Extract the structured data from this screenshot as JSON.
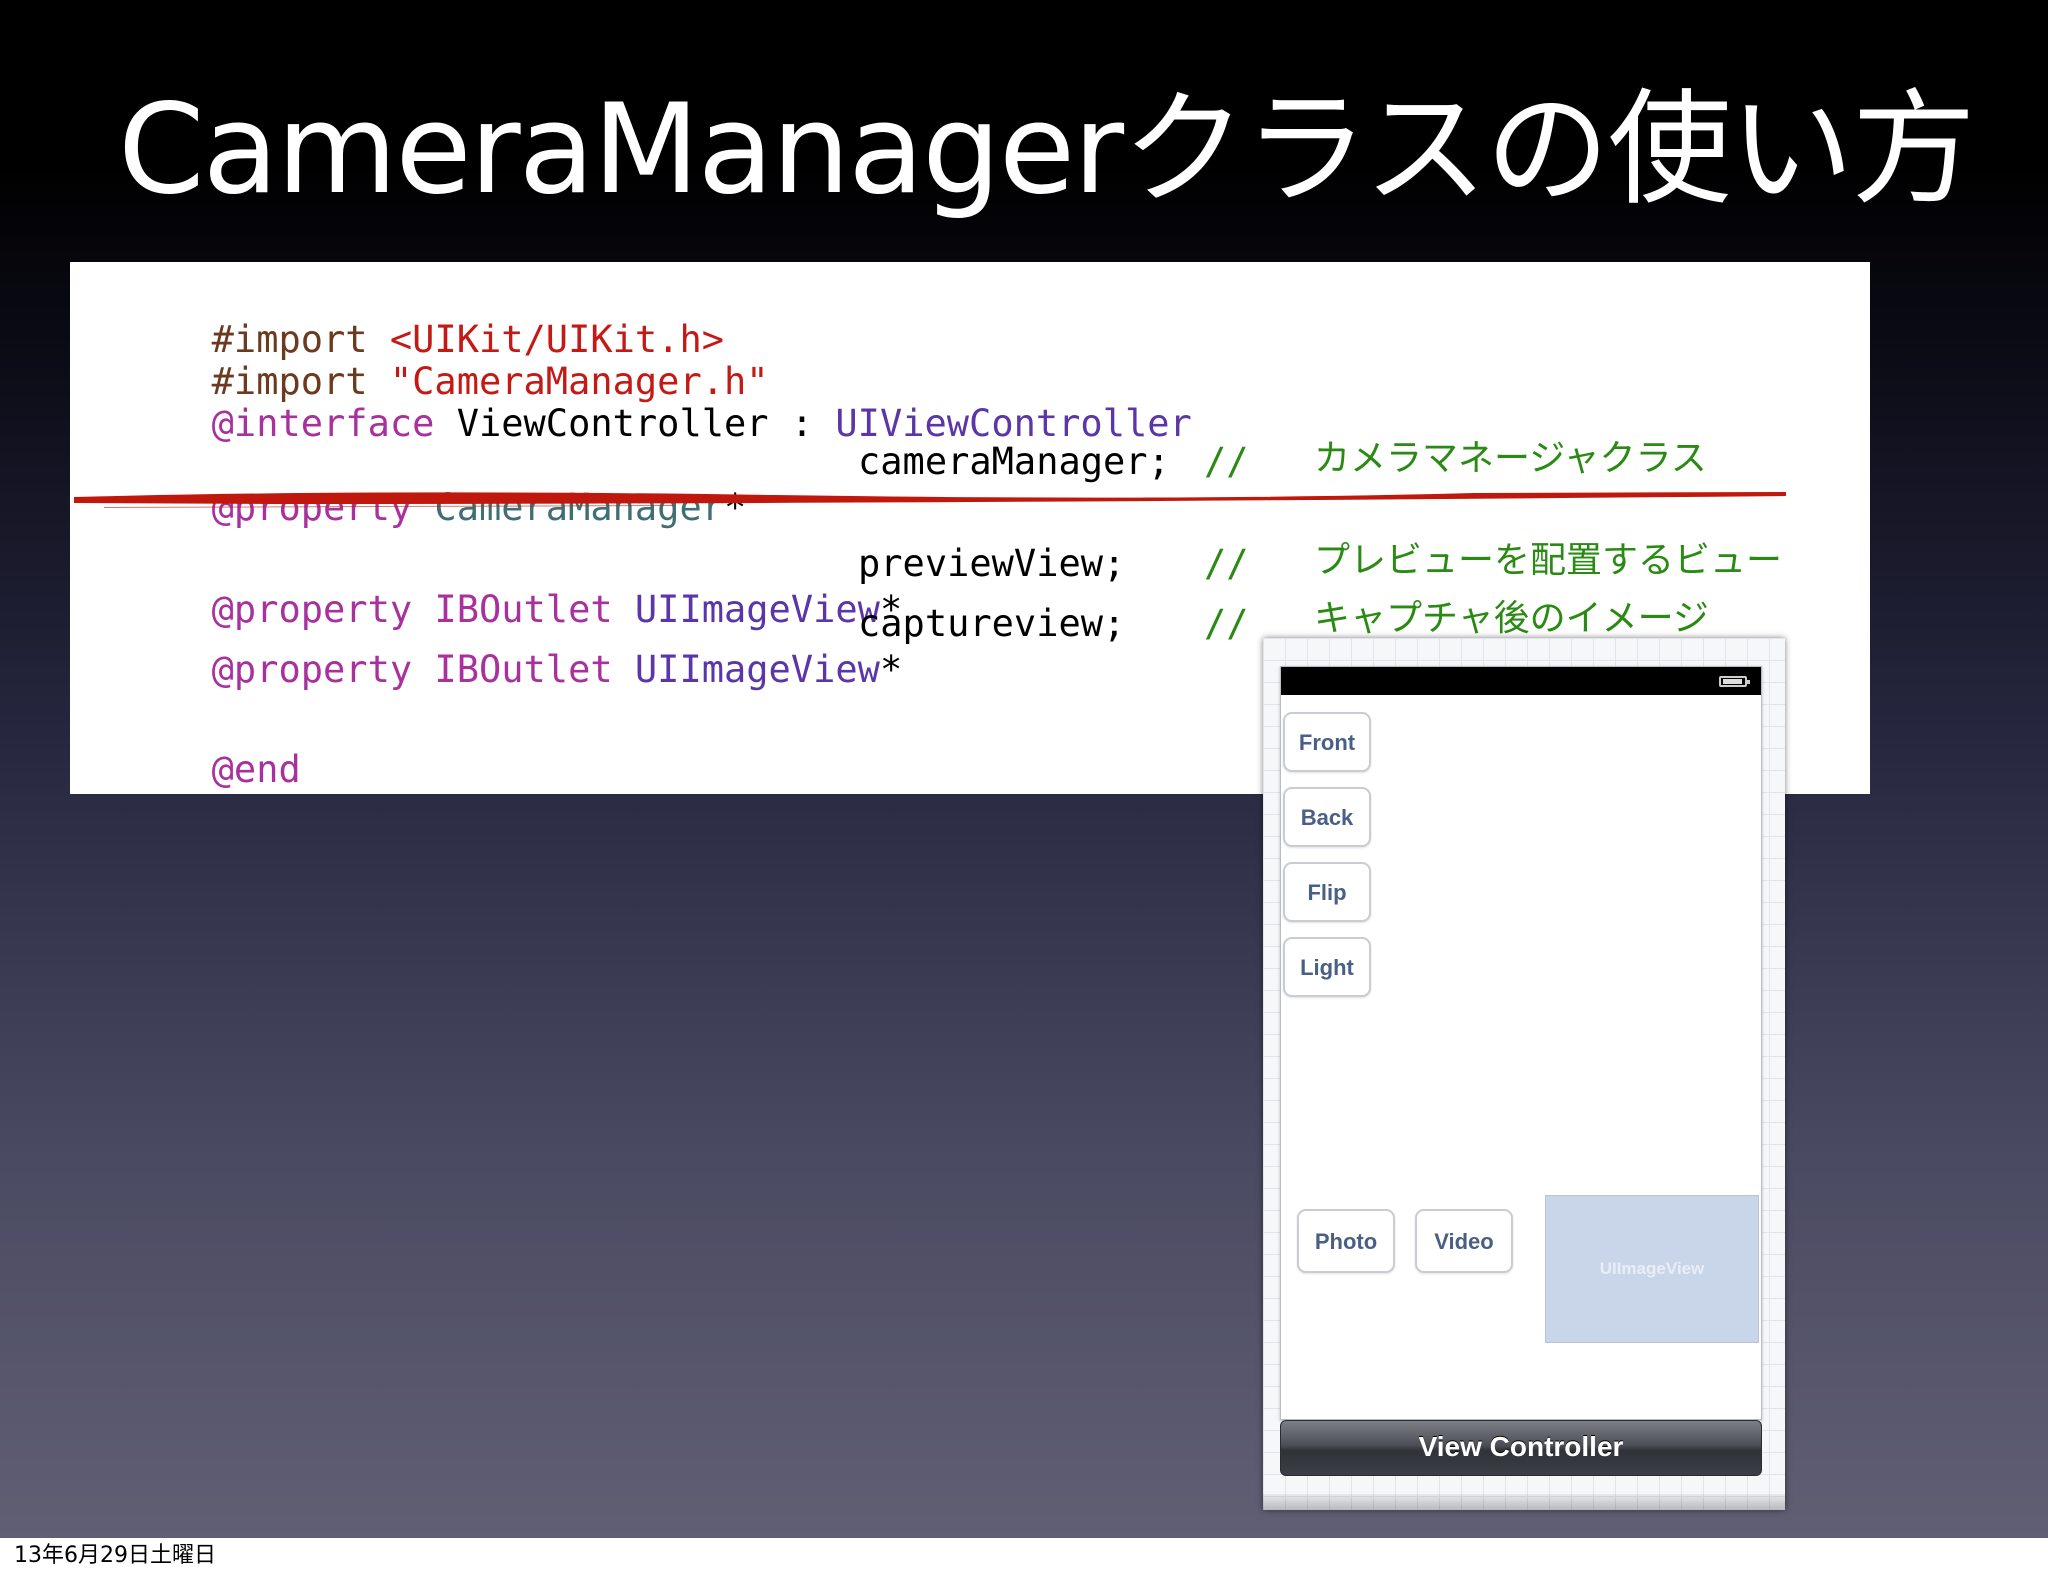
{
  "slide": {
    "title": "CameraManagerクラスの使い方",
    "footer_date": "13年6月29日土曜日"
  },
  "code": {
    "line1": {
      "directive": "#import ",
      "target": "<UIKit/UIKit.h>"
    },
    "line2": {
      "directive": "#import ",
      "target": "\"CameraManager.h\""
    },
    "line3": {
      "keyword": "@interface",
      "name": " ViewController : ",
      "superclass": "UIViewController"
    },
    "line4": {
      "keyword": "@property",
      "type": " CameraManager",
      "star": "*",
      "var": "cameraManager;",
      "comment_marker": "//",
      "comment": "カメラマネージャクラス"
    },
    "line5": {
      "keyword": "@property",
      "outlet": " IBOutlet",
      "type": " UIImageView",
      "star": "*",
      "var": "previewView;",
      "comment_marker": "//",
      "comment": "プレビューを配置するビュー"
    },
    "line6": {
      "keyword": "@property",
      "outlet": " IBOutlet",
      "type": " UIImageView",
      "star": "*",
      "var": "captureview;",
      "comment_marker": "//",
      "comment": "キャプチャ後のイメージ"
    },
    "line7": {
      "keyword": "@end"
    }
  },
  "storyboard": {
    "buttons": {
      "front": "Front",
      "back": "Back",
      "flip": "Flip",
      "light": "Light",
      "photo": "Photo",
      "video": "Video"
    },
    "image_view_label": "UIImageView",
    "scene_label": "View Controller"
  },
  "colors": {
    "code_preprocessor": "#6b3a1f",
    "code_string": "#c41a16",
    "code_keyword": "#a8319e",
    "code_type": "#5b36a8",
    "code_class": "#3f6e74",
    "code_comment": "#2a8a14",
    "highlight_underline": "#c0180c",
    "button_text": "#4a5f85",
    "image_view_fill": "#c9d6ea"
  }
}
